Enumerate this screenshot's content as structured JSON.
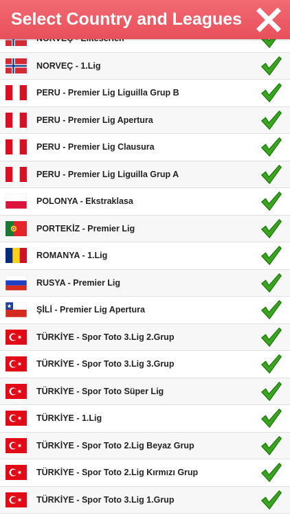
{
  "header": {
    "title": "Select Country and Leagues",
    "background": "#e8505b",
    "close_icon": "close-x-icon"
  },
  "rows": [
    {
      "label": "NORVEÇ - Eliteserien",
      "flag": "norway"
    },
    {
      "label": "NORVEÇ - 1.Lig",
      "flag": "norway"
    },
    {
      "label": "PERU - Premier Lig Liguilla Grup B",
      "flag": "peru"
    },
    {
      "label": "PERU - Premier Lig Apertura",
      "flag": "peru"
    },
    {
      "label": "PERU - Premier Lig Clausura",
      "flag": "peru"
    },
    {
      "label": "PERU - Premier Lig Liguilla Grup A",
      "flag": "peru"
    },
    {
      "label": "POLONYA - Ekstraklasa",
      "flag": "poland"
    },
    {
      "label": "PORTEKİZ - Premier Lig",
      "flag": "portugal"
    },
    {
      "label": "ROMANYA - 1.Lig",
      "flag": "romania"
    },
    {
      "label": "RUSYA - Premier Lig",
      "flag": "russia"
    },
    {
      "label": "ŞİLİ - Premier Lig Apertura",
      "flag": "chile"
    },
    {
      "label": "TÜRKİYE - Spor Toto 3.Lig 2.Grup",
      "flag": "turkey"
    },
    {
      "label": "TÜRKİYE - Spor Toto 3.Lig 3.Grup",
      "flag": "turkey"
    },
    {
      "label": "TÜRKİYE - Spor Toto Süper Lig",
      "flag": "turkey"
    },
    {
      "label": "TÜRKİYE - 1.Lig",
      "flag": "turkey"
    },
    {
      "label": "TÜRKİYE - Spor Toto 2.Lig Beyaz Grup",
      "flag": "turkey"
    },
    {
      "label": "TÜRKİYE - Spor Toto 2.Lig Kırmızı Grup",
      "flag": "turkey"
    },
    {
      "label": "TÜRKİYE - Spor Toto 3.Lig 1.Grup",
      "flag": "turkey"
    }
  ],
  "check_icon": "green-checkmark-icon",
  "check_color": "#2e9a1a"
}
